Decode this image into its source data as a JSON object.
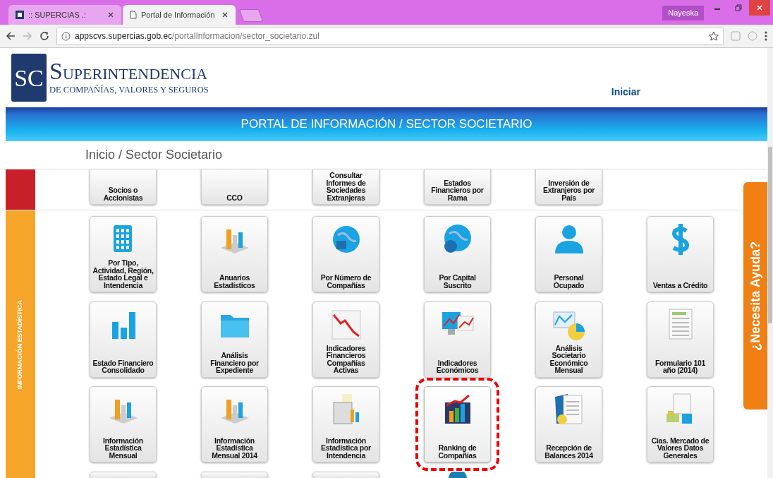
{
  "browser": {
    "tabs": [
      {
        "title": ":: SUPERCIAS .:",
        "selected": false
      },
      {
        "title": "Portal de Información",
        "selected": true
      }
    ],
    "user": "Nayeska",
    "address": {
      "host": "appscvs.supercias.gob.ec",
      "path": "/portalInformacion/sector_societario.zul"
    }
  },
  "header": {
    "logo": {
      "monogram": "SC",
      "title": "SUPERINTENDENCIA",
      "subtitle": "DE COMPAÑÍAS, VALORES Y SEGUROS"
    },
    "nav_link": "Iniciar",
    "banner": "PORTAL DE INFORMACIÓN / SECTOR SOCIETARIO",
    "breadcrumb": "Inicio / Sector Societario"
  },
  "top_row": [
    {
      "label": "Socios o Accionistas"
    },
    {
      "label": "CCO"
    },
    {
      "label": "Consultar Informes de Sociedades Extranjeras"
    },
    {
      "label": "Estados Financieros por Rama"
    },
    {
      "label": "Inversión de Extranjeros por País"
    }
  ],
  "section": {
    "title": "INFORMACIÓN ESTADÍSTICA",
    "tiles": [
      {
        "label": "Por Tipo, Actividad, Región, Estado Legal e Intendencia",
        "kind": "building",
        "selected": false
      },
      {
        "label": "Anuarios Estadísticos",
        "kind": "barchart",
        "selected": false
      },
      {
        "label": "Por Número de Compañías",
        "kind": "globe",
        "selected": false
      },
      {
        "label": "Por Capital Suscrito",
        "kind": "globedollar",
        "selected": false
      },
      {
        "label": "Personal Ocupado",
        "kind": "person",
        "selected": false
      },
      {
        "label": "Ventas a Crédito",
        "kind": "dollar",
        "selected": false
      },
      {
        "label": "Estado Financiero Consolidado",
        "kind": "bars",
        "selected": false
      },
      {
        "label": "Análisis Financiero por Expediente",
        "kind": "folder",
        "selected": false
      },
      {
        "label": "Indicadores Financieros Compañías Activas",
        "kind": "linechart",
        "selected": false
      },
      {
        "label": "Indicadores Económicos",
        "kind": "monitor",
        "selected": false
      },
      {
        "label": "Análisis Societario Económico Mensual",
        "kind": "piechart",
        "selected": false
      },
      {
        "label": "Formulario 101 año (2014)",
        "kind": "document",
        "selected": false
      },
      {
        "label": "Información Estadística Mensual",
        "kind": "barchart",
        "selected": false
      },
      {
        "label": "Información Estadística Mensual 2014",
        "kind": "barchart",
        "selected": false
      },
      {
        "label": "Información Estadística por Intendencia",
        "kind": "ballot",
        "selected": false
      },
      {
        "label": "Ranking de Compañías",
        "kind": "ranking",
        "selected": true
      },
      {
        "label": "Recepción de Balances 2014",
        "kind": "documents",
        "selected": false
      },
      {
        "label": "Cias. Mercado de Valores Datos Generales",
        "kind": "money",
        "selected": false
      }
    ],
    "cut_tiles": [
      {
        "kind": "tile"
      },
      {
        "kind": "tile"
      },
      {
        "kind": "tile"
      },
      {
        "kind": "globe"
      }
    ]
  },
  "help_tab": "¿Necesita Ayuda?"
}
